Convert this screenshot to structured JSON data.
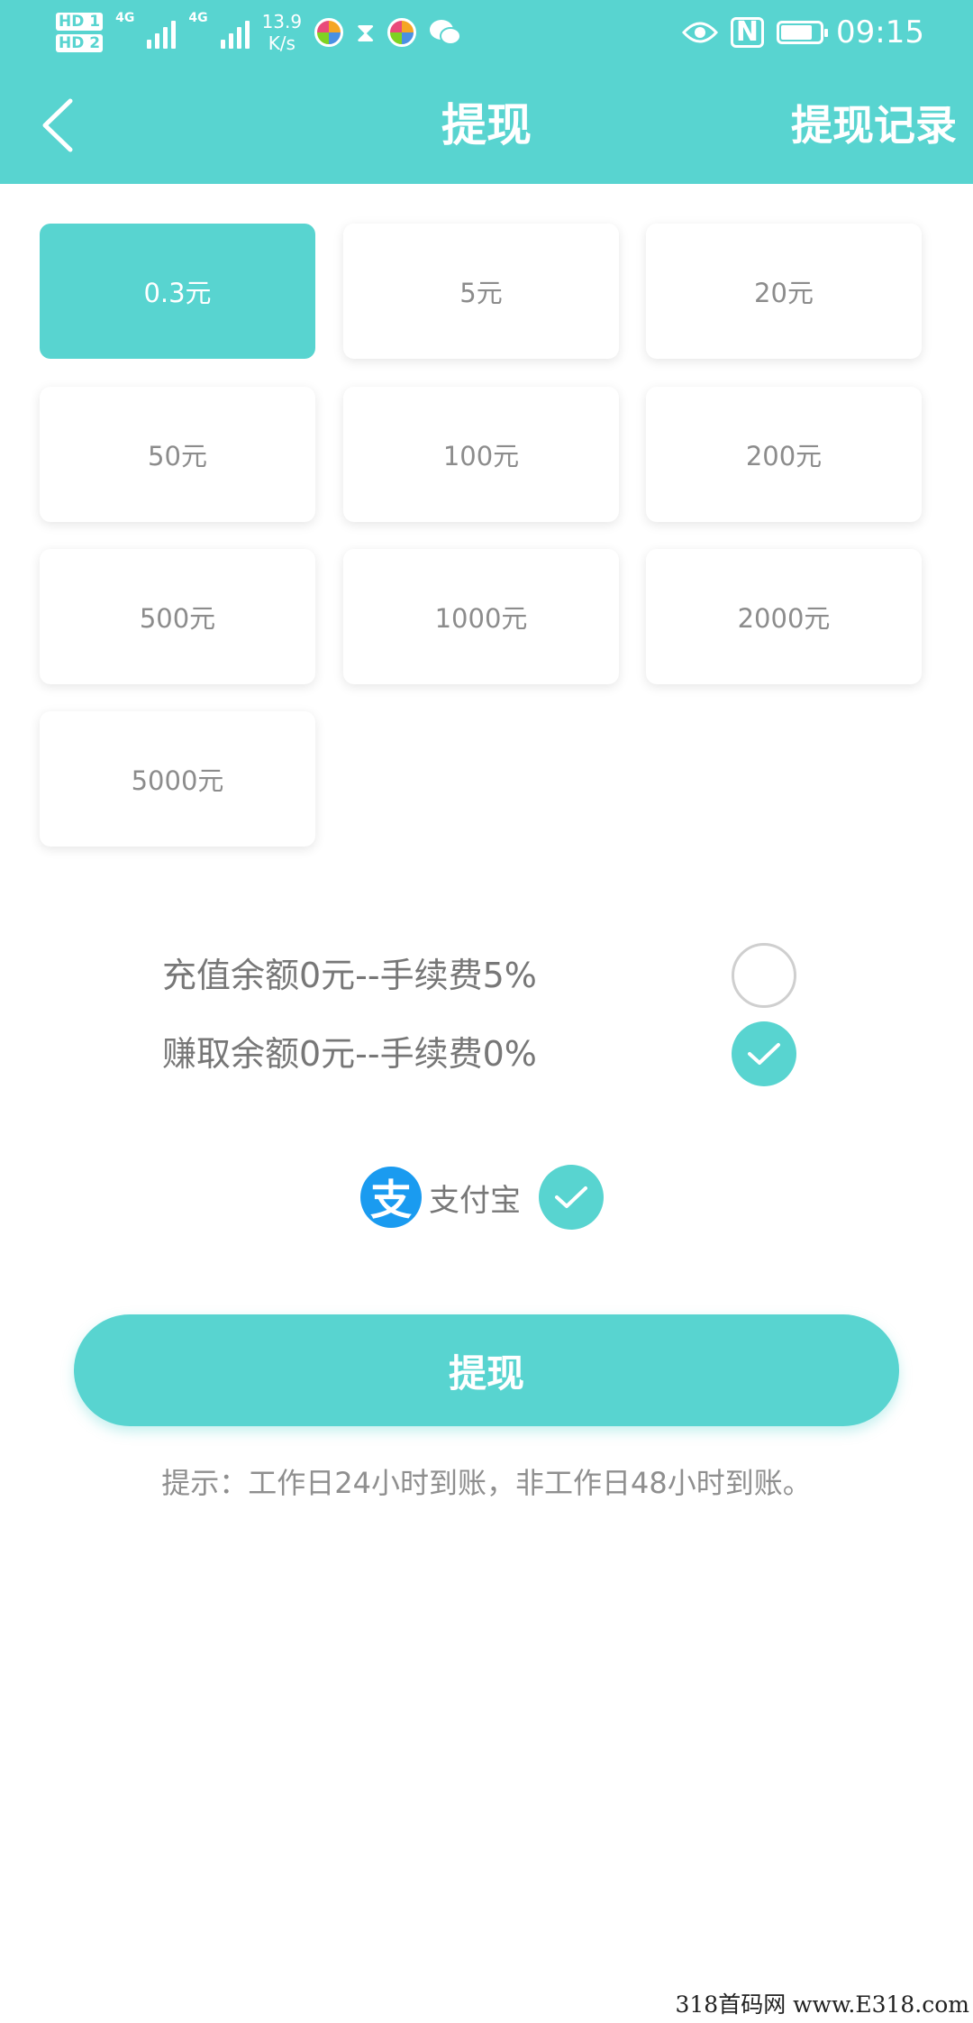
{
  "status_bar": {
    "hd1": "HD 1",
    "hd2": "HD 2",
    "net1": "4G",
    "net2": "4G",
    "speed_value": "13.9",
    "speed_unit": "K/s",
    "time": "09:15",
    "nfc": "N",
    "icons": [
      "hd-icon",
      "signal-icon",
      "app-icon",
      "hourglass-icon",
      "wechat-icon",
      "eye-icon",
      "nfc-icon",
      "battery-icon"
    ]
  },
  "header": {
    "title": "提现",
    "history_link": "提现记录"
  },
  "amounts": [
    {
      "label": "0.3元",
      "selected": true
    },
    {
      "label": "5元",
      "selected": false
    },
    {
      "label": "20元",
      "selected": false
    },
    {
      "label": "50元",
      "selected": false
    },
    {
      "label": "100元",
      "selected": false
    },
    {
      "label": "200元",
      "selected": false
    },
    {
      "label": "500元",
      "selected": false
    },
    {
      "label": "1000元",
      "selected": false
    },
    {
      "label": "2000元",
      "selected": false
    },
    {
      "label": "5000元",
      "selected": false
    }
  ],
  "balances": [
    {
      "label": "充值余额0元--手续费5%",
      "checked": false
    },
    {
      "label": "赚取余额0元--手续费0%",
      "checked": true
    }
  ],
  "payment": {
    "icon_glyph": "支",
    "label": "支付宝",
    "checked": true
  },
  "withdraw_button": "提现",
  "hint": "提示：工作日24小时到账，非工作日48小时到账。",
  "watermark": "318首码网 www.E318.com",
  "colors": {
    "accent": "#58d4d0",
    "alipay": "#1a9bf0",
    "text_gray": "#8c8c8c"
  }
}
